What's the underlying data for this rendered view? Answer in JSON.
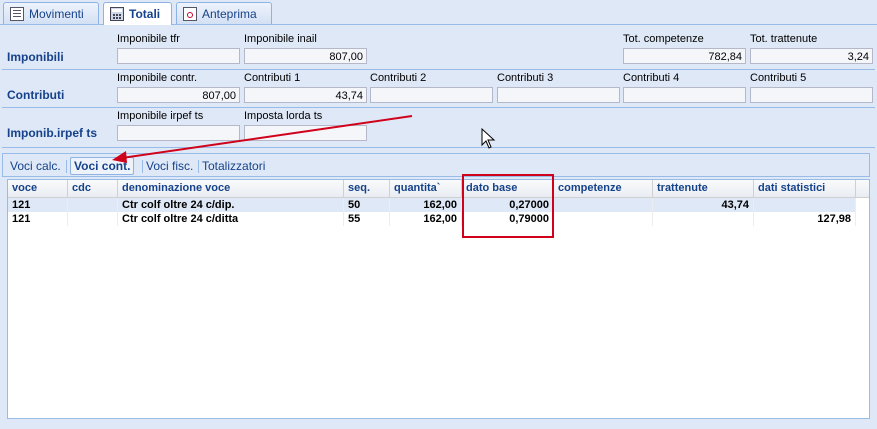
{
  "tabs": [
    {
      "label": "Movimenti",
      "icon": "list-icon",
      "active": false
    },
    {
      "label": "Totali",
      "icon": "calculator-icon",
      "active": true
    },
    {
      "label": "Anteprima",
      "icon": "preview-icon",
      "active": false
    }
  ],
  "imponibili": {
    "row_label": "Imponibili",
    "imponibile_tfr": {
      "label": "Imponibile tfr",
      "value": ""
    },
    "imponibile_inail": {
      "label": "Imponibile inail",
      "value": "807,00"
    },
    "tot_competenze": {
      "label": "Tot. competenze",
      "value": "782,84"
    },
    "tot_trattenute": {
      "label": "Tot. trattenute",
      "value": "3,24"
    }
  },
  "contributi": {
    "row_label": "Contributi",
    "imponibile_contr": {
      "label": "Imponibile contr.",
      "value": "807,00"
    },
    "contributi_1": {
      "label": "Contributi 1",
      "value": "43,74"
    },
    "contributi_2": {
      "label": "Contributi 2",
      "value": ""
    },
    "contributi_3": {
      "label": "Contributi 3",
      "value": ""
    },
    "contributi_4": {
      "label": "Contributi 4",
      "value": ""
    },
    "contributi_5": {
      "label": "Contributi 5",
      "value": ""
    }
  },
  "irpef": {
    "row_label": "Imponib.irpef ts",
    "imponibile_irpef_ts": {
      "label": "Imponibile irpef ts",
      "value": ""
    },
    "imposta_lorda_ts": {
      "label": "Imposta lorda ts",
      "value": ""
    }
  },
  "sub_tabs": [
    {
      "label": "Voci calc.",
      "active": false
    },
    {
      "label": "Voci cont.",
      "active": true
    },
    {
      "label": "Voci fisc.",
      "active": false
    },
    {
      "label": "Totalizzatori",
      "active": false
    }
  ],
  "grid": {
    "columns": [
      "voce",
      "cdc",
      "denominazione voce",
      "seq.",
      "quantita`",
      "dato base",
      "competenze",
      "trattenute",
      "dati statistici"
    ],
    "rows": [
      [
        "121",
        "",
        "Ctr colf oltre 24 c/dip.",
        "50",
        "162,00",
        "0,27000",
        "",
        "43,74",
        ""
      ],
      [
        "121",
        "",
        "Ctr colf oltre 24 c/ditta",
        "55",
        "162,00",
        "0,79000",
        "",
        "",
        "127,98"
      ]
    ]
  },
  "colors": {
    "annotation": "#d0021b"
  }
}
